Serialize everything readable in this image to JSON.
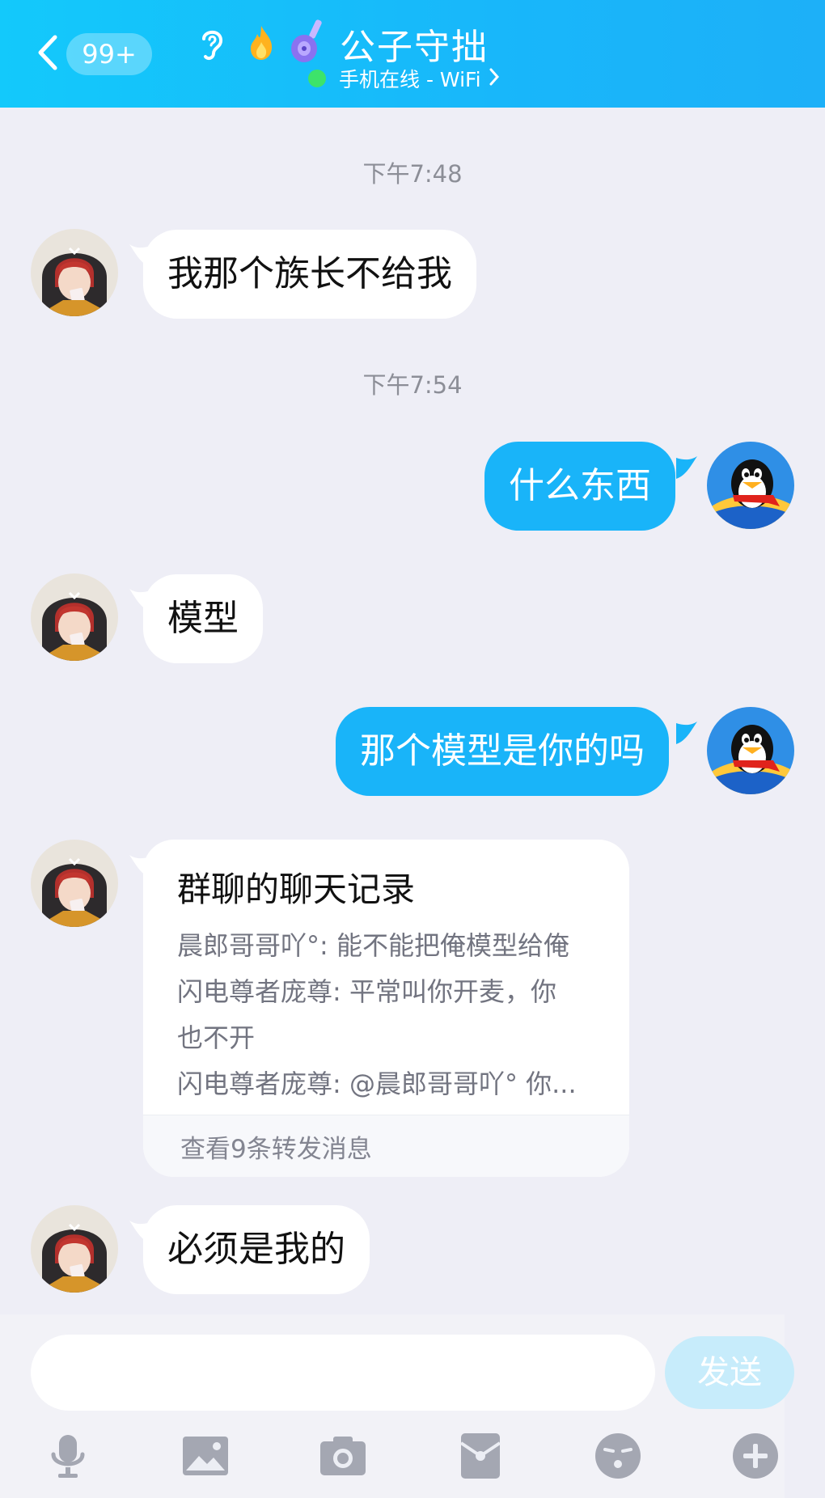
{
  "header": {
    "unread_badge": "99+",
    "title": "公子守拙",
    "status": "手机在线 - WiFi",
    "icons": [
      "back-chevron-icon",
      "ear-icon",
      "flame-icon",
      "guitar-icon",
      "chevron-right-icon"
    ]
  },
  "messages": {
    "time_1": "下午7:48",
    "msg_1": "我那个族长不给我",
    "time_2": "下午7:54",
    "msg_2": "什么东西",
    "msg_3": "模型",
    "msg_4": "那个模型是你的吗",
    "forward_card": {
      "title": "群聊的聊天记录",
      "line_1": "晨郎哥哥吖°: 能不能把俺模型给俺",
      "line_2": "闪电尊者庞尊: 平常叫你开麦，你",
      "line_3": "也不开",
      "line_4": "闪电尊者庞尊: @晨郎哥哥吖° 你...",
      "footer": "查看9条转发消息"
    },
    "msg_5": "必须是我的"
  },
  "input": {
    "placeholder": "",
    "send_label": "发送"
  },
  "toolbar": [
    "microphone-icon",
    "image-icon",
    "camera-icon",
    "red-packet-icon",
    "emoji-icon",
    "plus-icon"
  ],
  "colors": {
    "header_start": "#13c9fb",
    "header_end": "#1db0f8",
    "outgoing_bubble": "#19b4f9",
    "incoming_bubble": "#ffffff",
    "background": "#eeeef6",
    "online_dot": "#3de36a"
  }
}
